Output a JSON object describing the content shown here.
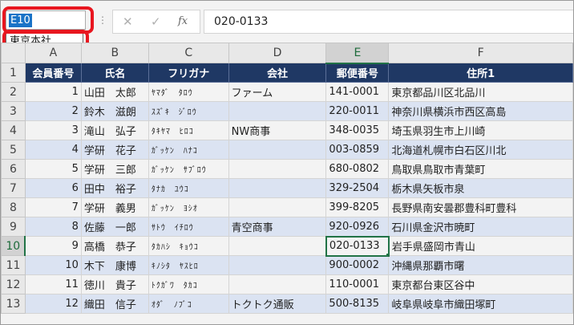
{
  "name_box": {
    "value": "E10"
  },
  "name_dropdown": {
    "item": "東京本社"
  },
  "formula_bar": {
    "separator_icon": "vertical-dots",
    "cancel_icon": "✕",
    "enter_icon": "✓",
    "fx_label": "fx",
    "value": "020-0133"
  },
  "columns": [
    "A",
    "B",
    "C",
    "D",
    "E",
    "F"
  ],
  "active_column": "E",
  "active_row": "10",
  "header_labels": [
    "会員番号",
    "氏名",
    "フリガナ",
    "会社",
    "郵便番号",
    "住所1"
  ],
  "rows": [
    {
      "num": "2",
      "id": "1",
      "name": "山田　太郎",
      "kana": "ﾔﾏﾀﾞ　ﾀﾛｳ",
      "company": "ファーム",
      "zip": "141-0001",
      "address": "東京都品川区北品川"
    },
    {
      "num": "3",
      "id": "2",
      "name": "鈴木　滋朗",
      "kana": "ｽｽﾞｷ　ｼﾞﾛｳ",
      "company": "",
      "zip": "220-0011",
      "address": "神奈川県横浜市西区高島"
    },
    {
      "num": "4",
      "id": "3",
      "name": "滝山　弘子",
      "kana": "ﾀｷﾔﾏ　ﾋﾛｺ",
      "company": "NW商事",
      "zip": "348-0035",
      "address": "埼玉県羽生市上川崎"
    },
    {
      "num": "5",
      "id": "4",
      "name": "学研　花子",
      "kana": "ｶﾞｯｹﾝ　ﾊﾅｺ",
      "company": "",
      "zip": "003-0859",
      "address": "北海道札幌市白石区川北"
    },
    {
      "num": "6",
      "id": "5",
      "name": "学研　三郎",
      "kana": "ｶﾞｯｹﾝ　ｻﾌﾞﾛｳ",
      "company": "",
      "zip": "680-0802",
      "address": "鳥取県鳥取市青葉町"
    },
    {
      "num": "7",
      "id": "6",
      "name": "田中　裕子",
      "kana": "ﾀﾅｶ　ﾕｳｺ",
      "company": "",
      "zip": "329-2504",
      "address": "栃木県矢板市泉"
    },
    {
      "num": "8",
      "id": "7",
      "name": "学研　義男",
      "kana": "ｶﾞｯｹﾝ　ﾖｼｵ",
      "company": "",
      "zip": "399-8205",
      "address": "長野県南安曇郡豊科町豊科"
    },
    {
      "num": "9",
      "id": "8",
      "name": "佐藤　一郎",
      "kana": "ｻﾄｳ　ｲﾁﾛｳ",
      "company": "青空商事",
      "zip": "920-0926",
      "address": "石川県金沢市暁町"
    },
    {
      "num": "10",
      "id": "9",
      "name": "高橋　恭子",
      "kana": "ﾀｶﾊｼ　ｷｮｳｺ",
      "company": "",
      "zip": "020-0133",
      "address": "岩手県盛岡市青山"
    },
    {
      "num": "11",
      "id": "10",
      "name": "木下　康博",
      "kana": "ｷﾉｼﾀ　ﾔｽﾋﾛ",
      "company": "",
      "zip": "900-0002",
      "address": "沖縄県那覇市曙"
    },
    {
      "num": "12",
      "id": "11",
      "name": "徳川　貴子",
      "kana": "ﾄｸｶﾞﾜ　ﾀｶｺ",
      "company": "",
      "zip": "110-0001",
      "address": "東京都台東区谷中"
    },
    {
      "num": "13",
      "id": "12",
      "name": "織田　信子",
      "kana": "ｵﾀﾞ　ﾉﾌﾞｺ",
      "company": "トクトク通販",
      "zip": "500-8135",
      "address": "岐阜県岐阜市織田塚町"
    }
  ],
  "colors": {
    "header_fill": "#1f3864",
    "band_fill": "#dbe3f2",
    "selection": "#217346",
    "highlight": "#e8161f"
  }
}
